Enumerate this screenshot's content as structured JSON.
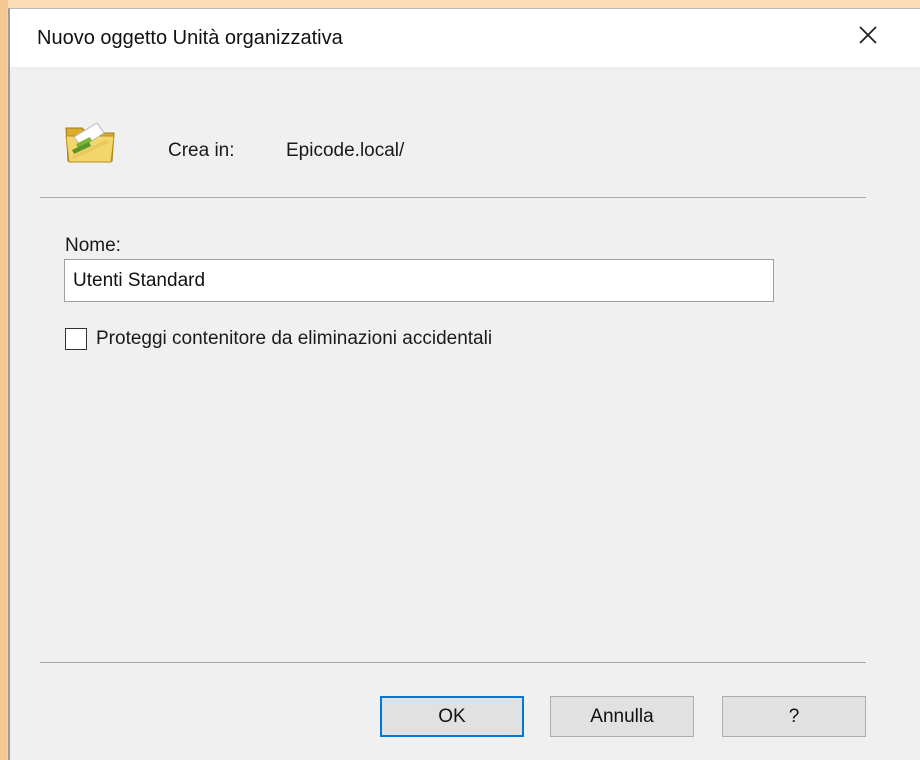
{
  "window": {
    "title": "Nuovo oggetto Unità organizzativa",
    "close_icon": "close-icon"
  },
  "header": {
    "icon": "organizational-unit-folder-icon",
    "create_label": "Crea in:",
    "create_value": "Epicode.local/"
  },
  "form": {
    "name_label": "Nome:",
    "name_value": "Utenti Standard",
    "protect_label": "Proteggi contenitore da eliminazioni accidentali",
    "protect_checked": false
  },
  "buttons": {
    "ok": "OK",
    "cancel": "Annulla",
    "help": "?"
  },
  "colors": {
    "focus_accent": "#0078d7",
    "dialog_background": "#f0f0f0",
    "outer_background": "#fbdcb6"
  }
}
